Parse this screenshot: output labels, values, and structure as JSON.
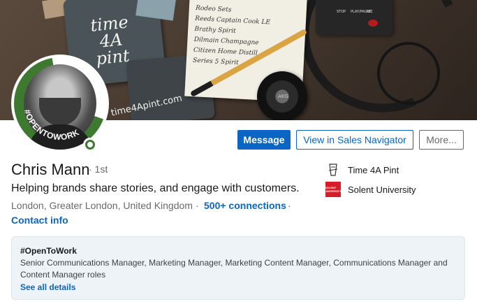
{
  "cover": {
    "coaster_text": "time\n4A\npint",
    "coaster_link": "time4Apint.com",
    "notebook_lines": [
      "Rodeo Sets",
      "Reeds Captain Cook LE",
      "Brathy Spirit",
      "Dilmain Champagne",
      "Citizen Home Distill",
      "Series 5 Spirit"
    ],
    "recorder_labels": [
      "STOP",
      "PLAY/PAUSE",
      "REC"
    ],
    "headphone_logo": "AKG"
  },
  "avatar": {
    "badge_text": "#OPENTOWORK",
    "ring_color": "#3d7a2f"
  },
  "actions": {
    "message_label": "Message",
    "sales_navigator_label": "View in Sales Navigator",
    "more_label": "More..."
  },
  "profile": {
    "name": "Chris Mann",
    "degree": "· 1st",
    "headline": "Helping brands share stories, and engage with customers.",
    "location": "London, Greater London, United Kingdom",
    "separator": "·",
    "connections": "500+ connections",
    "contact_info": "Contact info"
  },
  "organizations": [
    {
      "name": "Time 4A Pint",
      "icon": "time4apint-logo-icon"
    },
    {
      "name": "Solent University",
      "icon": "solent-logo-icon",
      "logo_text": "SOLENT UNIVERSITY"
    }
  ],
  "open_to_work": {
    "title": "#OpenToWork",
    "roles": "Senior Communications Manager, Marketing Manager, Marketing Content Manager, Communications Manager and Content Manager roles",
    "link": "See all details"
  },
  "colors": {
    "brand_blue": "#0a66c2",
    "otw_green": "#3d7a2f",
    "card_bg": "#eef3f8"
  }
}
